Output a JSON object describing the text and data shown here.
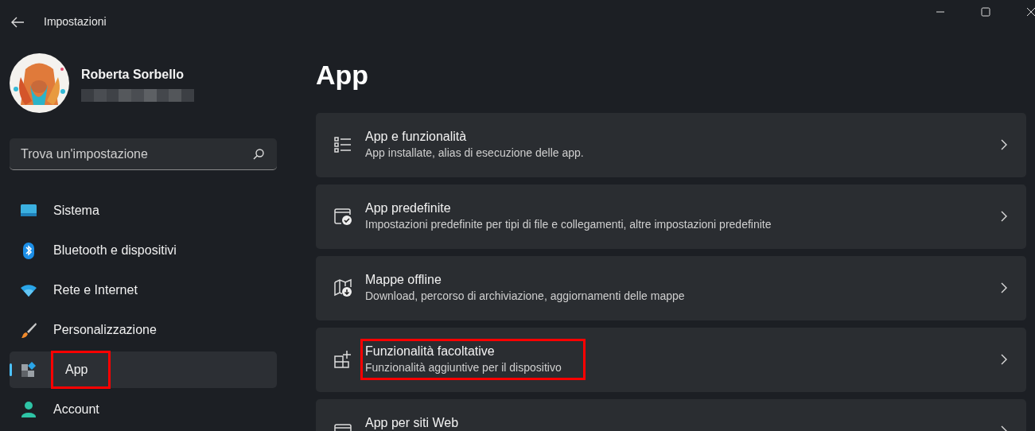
{
  "window": {
    "title": "Impostazioni"
  },
  "account": {
    "name": "Roberta Sorbello",
    "email_redacted": true
  },
  "search": {
    "placeholder": "Trova un'impostazione"
  },
  "sidebar": {
    "items": [
      {
        "label": "Sistema",
        "selected": false,
        "highlighted": false
      },
      {
        "label": "Bluetooth e dispositivi",
        "selected": false,
        "highlighted": false
      },
      {
        "label": "Rete e Internet",
        "selected": false,
        "highlighted": false
      },
      {
        "label": "Personalizzazione",
        "selected": false,
        "highlighted": false
      },
      {
        "label": "App",
        "selected": true,
        "highlighted": true
      },
      {
        "label": "Account",
        "selected": false,
        "highlighted": false
      }
    ]
  },
  "page": {
    "title": "App"
  },
  "cards": [
    {
      "title": "App e funzionalità",
      "subtitle": "App installate, alias di esecuzione delle app.",
      "highlighted": false
    },
    {
      "title": "App predefinite",
      "subtitle": "Impostazioni predefinite per tipi di file e collegamenti, altre impostazioni predefinite",
      "highlighted": false
    },
    {
      "title": "Mappe offline",
      "subtitle": "Download, percorso di archiviazione, aggiornamenti delle mappe",
      "highlighted": false
    },
    {
      "title": "Funzionalità facoltative",
      "subtitle": "Funzionalità aggiuntive per il dispositivo",
      "highlighted": true
    },
    {
      "title": "App per siti Web",
      "highlighted": false
    }
  ]
}
